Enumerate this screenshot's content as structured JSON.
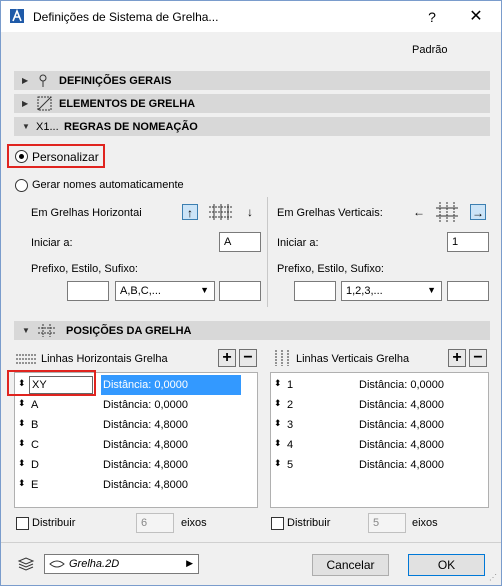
{
  "window": {
    "title": "Definições de Sistema de Grelha...",
    "help": "?",
    "close": "✕"
  },
  "preset": "Padrão",
  "sections": {
    "general": "DEFINIÇÕES GERAIS",
    "elements": "ELEMENTOS DE GRELHA",
    "naming": "REGRAS DE NOMEAÇÃO",
    "naming_icon_text": "X1...",
    "positions": "POSIÇÕES DA GRELHA"
  },
  "naming": {
    "custom_label": "Personalizar",
    "custom_selected": true,
    "auto_label": "Gerar nomes automaticamente",
    "auto_selected": false,
    "horizontal": {
      "label": "Em Grelhas Horizontai",
      "start_label": "Iniciar a:",
      "start_value": "A",
      "prefix_label": "Prefixo, Estilo, Sufixo:",
      "prefix_value": "",
      "style_value": "A,B,C,...",
      "suffix_value": "",
      "up_arrow": "↑",
      "down_arrow": "↓"
    },
    "vertical": {
      "label": "Em Grelhas Verticais:",
      "start_label": "Iniciar a:",
      "start_value": "1",
      "prefix_label": "Prefixo, Estilo, Sufixo:",
      "prefix_value": "",
      "style_value": "1,2,3,...",
      "suffix_value": "",
      "left_arrow": "←",
      "right_arrow": "→"
    }
  },
  "positions": {
    "horizontal": {
      "title": "Linhas Horizontais Grelha",
      "rows": [
        {
          "name": "XY",
          "distance": "Distância: 0,0000",
          "selected": true
        },
        {
          "name": "A",
          "distance": "Distância: 0,0000"
        },
        {
          "name": "B",
          "distance": "Distância: 4,8000"
        },
        {
          "name": "C",
          "distance": "Distância: 4,8000"
        },
        {
          "name": "D",
          "distance": "Distância: 4,8000"
        },
        {
          "name": "E",
          "distance": "Distância: 4,8000"
        }
      ],
      "distribute_label": "Distribuir",
      "distribute_count": "6",
      "axes_label": "eixos"
    },
    "vertical": {
      "title": "Linhas Verticais Grelha",
      "rows": [
        {
          "name": "1",
          "distance": "Distância: 0,0000"
        },
        {
          "name": "2",
          "distance": "Distância: 4,8000"
        },
        {
          "name": "3",
          "distance": "Distância: 4,8000"
        },
        {
          "name": "4",
          "distance": "Distância: 4,8000"
        },
        {
          "name": "5",
          "distance": "Distância: 4,8000"
        }
      ],
      "distribute_label": "Distribuir",
      "distribute_count": "5",
      "axes_label": "eixos"
    },
    "add": "+",
    "remove": "−"
  },
  "footer": {
    "layer_value": "Grelha.2D",
    "cancel": "Cancelar",
    "ok": "OK"
  },
  "colors": {
    "highlight": "#e0241f",
    "selection": "#3399ff"
  }
}
